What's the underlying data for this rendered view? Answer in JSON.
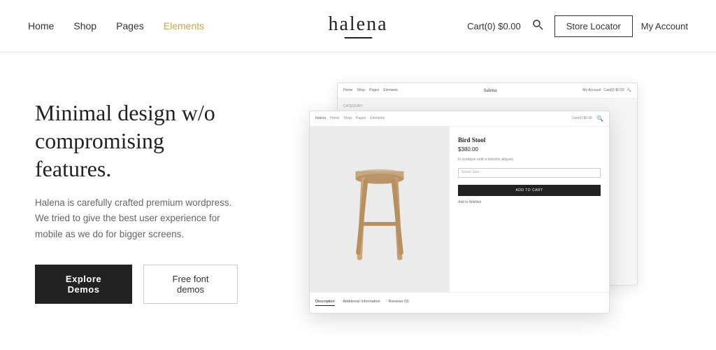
{
  "header": {
    "nav": {
      "home": "Home",
      "shop": "Shop",
      "pages": "Pages",
      "elements": "Elements"
    },
    "logo": "halena",
    "cart": "Cart(0)  $0.00",
    "store_locator": "Store Locator",
    "my_account": "My Account"
  },
  "hero": {
    "headline": "Minimal design w/o compromising features.",
    "subtext": "Halena is carefully crafted premium wordpress. We tried to give the best user experience for mobile as we do for bigger screens.",
    "btn_explore": "Explore Demos",
    "btn_free": "Free font demos"
  },
  "mockup": {
    "nav_items": [
      "Home",
      "Shop",
      "Pages",
      "Elements"
    ],
    "logo": "halena",
    "product": {
      "title": "Bird Stool",
      "price": "$380.00",
      "desc": "In tristique velit a lobortis aliquet.",
      "select_placeholder": "Select Size",
      "add_to_cart": "ADD TO CART",
      "wishlist": "Add to Wishlist"
    },
    "footer_tabs": [
      "Description",
      "Additional Information",
      "Reviews (0)"
    ]
  }
}
